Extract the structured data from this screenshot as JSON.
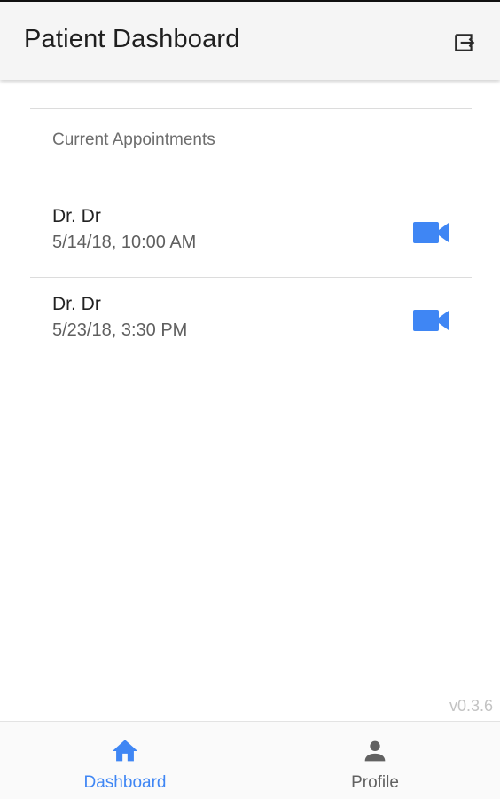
{
  "header": {
    "title": "Patient Dashboard",
    "logout_icon": "logout-icon"
  },
  "main": {
    "section_label": "Current Appointments",
    "appointments": [
      {
        "doctor": "Dr. Dr",
        "datetime": "5/14/18, 10:00 AM",
        "action_icon": "video-camera-icon"
      },
      {
        "doctor": "Dr. Dr",
        "datetime": "5/23/18, 3:30 PM",
        "action_icon": "video-camera-icon"
      }
    ]
  },
  "version": "v0.3.6",
  "bottom_nav": {
    "items": [
      {
        "label": "Dashboard",
        "icon": "home-icon",
        "active": true
      },
      {
        "label": "Profile",
        "icon": "person-icon",
        "active": false
      }
    ]
  },
  "colors": {
    "accent": "#3f86f4",
    "inactive": "#616161"
  }
}
